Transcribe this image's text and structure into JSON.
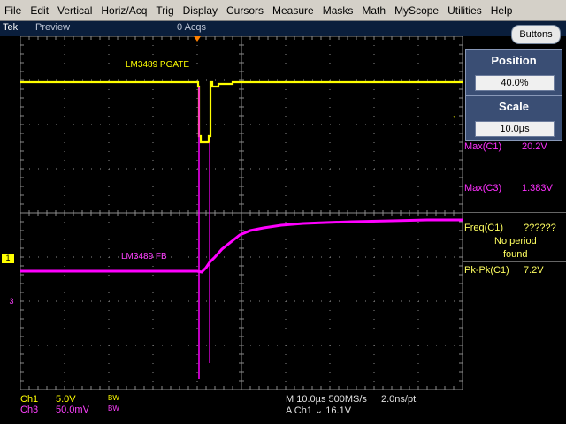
{
  "menu": [
    "File",
    "Edit",
    "Vertical",
    "Horiz/Acq",
    "Trig",
    "Display",
    "Cursors",
    "Measure",
    "Masks",
    "Math",
    "MyScope",
    "Utilities",
    "Help"
  ],
  "brand": "Tek",
  "mode": "Preview",
  "acqs": "0 Acqs",
  "buttons_label": "Buttons",
  "position": {
    "title": "Position",
    "value": "40.0%"
  },
  "scale": {
    "title": "Scale",
    "value": "10.0µs"
  },
  "measurements": [
    {
      "label": "Max(C1)",
      "value": "20.2V"
    },
    {
      "label": "Max(C3)",
      "value": "1.383V"
    },
    {
      "label": "Freq(C1)",
      "value": "??????",
      "note1": "No period",
      "note2": "found"
    },
    {
      "label": "Pk-Pk(C1)",
      "value": "7.2V"
    }
  ],
  "waveforms": {
    "ch1_label": "LM3489 PGATE",
    "ch3_label": "LM3489 FB"
  },
  "markers": {
    "ch1": "1",
    "ch3": "3"
  },
  "status": {
    "ch1": {
      "name": "Ch1",
      "scale": "5.0V",
      "bw": "BW"
    },
    "ch3": {
      "name": "Ch3",
      "scale": "50.0mV",
      "bw": "BW"
    },
    "timebase": "M 10.0µs 500MS/s",
    "resolution": "2.0ns/pt",
    "trigger": "A  Ch1  ⌄  16.1V"
  },
  "colors": {
    "ch1": "#ffff00",
    "ch3": "#ff00ff",
    "grid": "#8a8a8a",
    "panel": "#3a4e74"
  }
}
